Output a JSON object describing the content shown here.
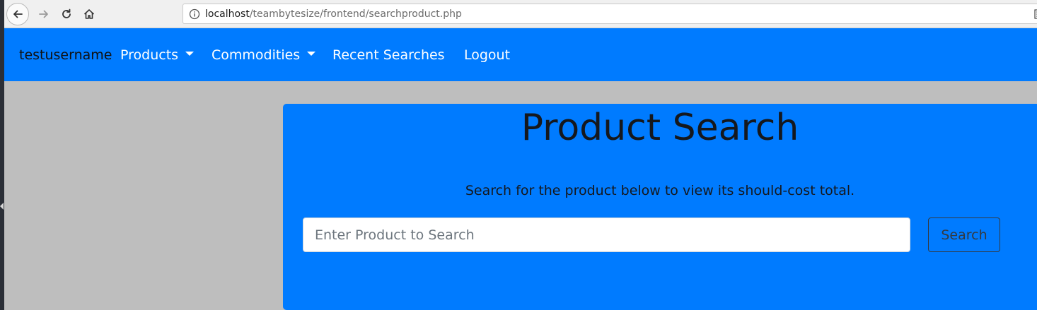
{
  "browser": {
    "url_host": "localhost",
    "url_path": "/teambytesize/frontend/searchproduct.php",
    "icons": [
      "back-icon",
      "forward-icon",
      "reload-icon",
      "home-icon",
      "info-icon",
      "reader-view-icon"
    ]
  },
  "navbar": {
    "brand": "testusername",
    "items": [
      {
        "label": "Products",
        "dropdown": true
      },
      {
        "label": "Commodities",
        "dropdown": true
      },
      {
        "label": "Recent Searches",
        "dropdown": false
      },
      {
        "label": "Logout",
        "dropdown": false
      }
    ]
  },
  "search_card": {
    "title": "Product Search",
    "subtitle": "Search for the product below to view its should-cost total.",
    "input_placeholder": "Enter Product to Search",
    "input_value": "",
    "button_label": "Search"
  },
  "colors": {
    "primary": "#007bff",
    "page_background": "#bebebe",
    "title_text": "#15181d"
  }
}
